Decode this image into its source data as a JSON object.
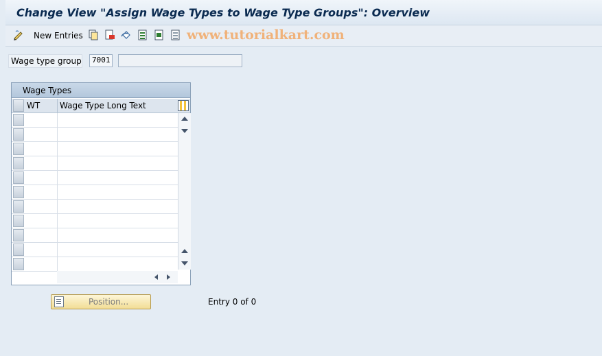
{
  "window": {
    "title": "Change View \"Assign Wage Types to Wage Type Groups\": Overview"
  },
  "toolbar": {
    "new_entries_label": "New Entries",
    "watermark": "www.tutorialkart.com",
    "icons": [
      "edit-pencil-icon",
      "copy-icon",
      "delete-icon",
      "undo-icon",
      "select-all-icon",
      "select-block-icon",
      "deselect-all-icon"
    ]
  },
  "header_field": {
    "label": "Wage type group",
    "value": "7001",
    "description": ""
  },
  "table": {
    "title": "Wage Types",
    "columns": [
      "WT",
      "Wage Type Long Text"
    ],
    "rows": [
      {
        "wt": "",
        "text": ""
      },
      {
        "wt": "",
        "text": ""
      },
      {
        "wt": "",
        "text": ""
      },
      {
        "wt": "",
        "text": ""
      },
      {
        "wt": "",
        "text": ""
      },
      {
        "wt": "",
        "text": ""
      },
      {
        "wt": "",
        "text": ""
      },
      {
        "wt": "",
        "text": ""
      },
      {
        "wt": "",
        "text": ""
      },
      {
        "wt": "",
        "text": ""
      },
      {
        "wt": "",
        "text": ""
      }
    ]
  },
  "footer": {
    "position_button_label": "Position...",
    "entry_counter": "Entry 0 of 0"
  }
}
